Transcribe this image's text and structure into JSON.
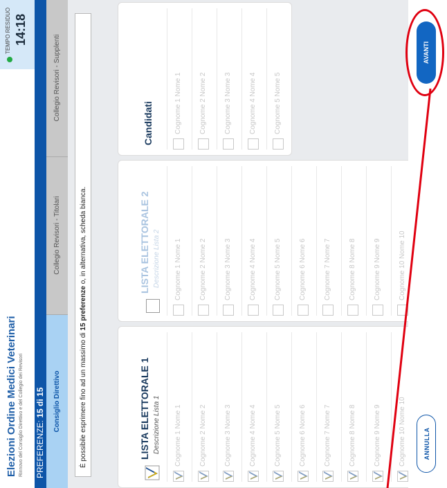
{
  "header": {
    "title": "Elezioni Ordine Medici Veterinari",
    "subtitle": "Rinnovo del Consiglio Direttivo e del Collegio dei Revisori",
    "timer_label": "TEMPO RESIDUO",
    "timer_value": "14:18"
  },
  "preferences": {
    "prefix": "PREFERENZE: ",
    "count": "15 di 15"
  },
  "tabs": [
    {
      "label": "Consiglio Direttivo"
    },
    {
      "label": "Collegio Revisori - Titolari"
    },
    {
      "label": "Collegio Revisori - Supplenti"
    }
  ],
  "info": {
    "before": "È possibile esprimere fino ad un massimo di ",
    "bold": "15 preferenze",
    "after": " o, in alternativa, scheda bianca."
  },
  "lista1": {
    "title": "LISTA ELETTORALE 1",
    "description": "Descrizione Lista 1",
    "rows": [
      "Cognome 1 Nome 1",
      "Cognome 2 Nome 2",
      "Cognome 3 Nome 3",
      "Cognome 4 Nome 4",
      "Cognome 5 Nome 5",
      "Cognome 6 Nome 6",
      "Cognome 7 Nome 7",
      "Cognome 8 Nome 8",
      "Cognome 9 Nome 9",
      "Cognome 10 Nome 10"
    ]
  },
  "lista2": {
    "title": "LISTA ELETTORALE 2",
    "description": "Descrizione Lista 2",
    "rows": [
      "Cognome 1 Nome 1",
      "Cognome 2 Nome 2",
      "Cognome 3 Nome 3",
      "Cognome 4 Nome 4",
      "Cognome 5 Nome 5",
      "Cognome 6 Nome 6",
      "Cognome 7 Nome 7",
      "Cognome 8 Nome 8",
      "Cognome 9 Nome 9",
      "Cognome 10 Nome 10"
    ]
  },
  "candidati": {
    "title": "Candidati",
    "rows": [
      "Cognome 1 Nome 1",
      "Cognome 2 Nome 2",
      "Cognome 3 Nome 3",
      "Cognome 4 Nome 4",
      "Cognome 5 Nome 5"
    ]
  },
  "footer": {
    "annulla": "ANNULLA",
    "avanti": "AVANTI"
  },
  "colors": {
    "accent": "#0d55a8",
    "active_tab": "#a9d2f3",
    "highlight": "#e00010"
  }
}
